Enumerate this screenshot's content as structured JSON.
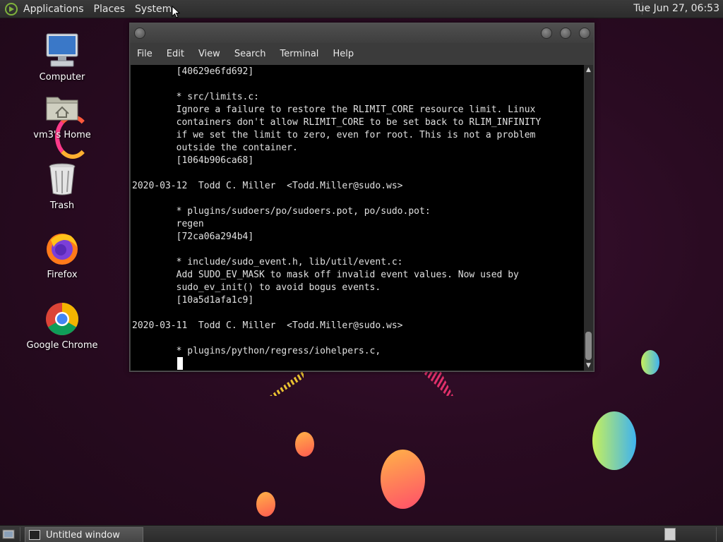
{
  "top_panel": {
    "menus": [
      "Applications",
      "Places",
      "System"
    ],
    "clock": "Tue Jun 27, 06:53"
  },
  "desktop": {
    "icons": [
      {
        "label": "Computer",
        "icon": "computer-icon"
      },
      {
        "label": "vm3's Home",
        "icon": "home-folder-icon"
      },
      {
        "label": "Trash",
        "icon": "trash-icon"
      },
      {
        "label": "Firefox",
        "icon": "firefox-icon"
      },
      {
        "label": "Google Chrome",
        "icon": "chrome-icon"
      }
    ]
  },
  "terminal": {
    "menu": [
      "File",
      "Edit",
      "View",
      "Search",
      "Terminal",
      "Help"
    ],
    "lines": [
      "        [40629e6fd692]",
      "",
      "        * src/limits.c:",
      "        Ignore a failure to restore the RLIMIT_CORE resource limit. Linux",
      "        containers don't allow RLIMIT_CORE to be set back to RLIM_INFINITY",
      "        if we set the limit to zero, even for root. This is not a problem",
      "        outside the container.",
      "        [1064b906ca68]",
      "",
      "2020-03-12  Todd C. Miller  <Todd.Miller@sudo.ws>",
      "",
      "        * plugins/sudoers/po/sudoers.pot, po/sudo.pot:",
      "        regen",
      "        [72ca06a294b4]",
      "",
      "        * include/sudo_event.h, lib/util/event.c:",
      "        Add SUDO_EV_MASK to mask off invalid event values. Now used by",
      "        sudo_ev_init() to avoid bogus events.",
      "        [10a5d1afa1c9]",
      "",
      "2020-03-11  Todd C. Miller  <Todd.Miller@sudo.ws>",
      "",
      "        * plugins/python/regress/iohelpers.c,"
    ]
  },
  "taskbar": {
    "window_title": "Untitled window"
  }
}
